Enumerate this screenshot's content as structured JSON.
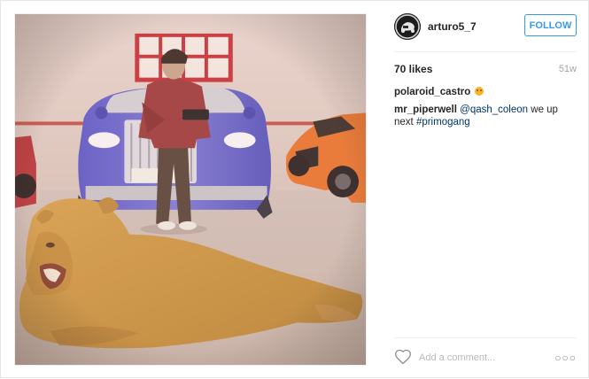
{
  "post": {
    "image_alt": "Man standing in a garage with a Rolls-Royce and an orange Lamborghini, a lioness lying on the floor in front",
    "icons": {
      "heart": "heart-outline-icon",
      "more": "more-options-icon"
    }
  },
  "header": {
    "username": "arturo5_7",
    "follow_label": "FOLLOW"
  },
  "stats": {
    "likes": "70 likes",
    "age": "51w"
  },
  "comments": [
    {
      "user": "polaroid_castro",
      "text": "",
      "emoji": "grinning-face"
    },
    {
      "user": "mr_piperwell",
      "mention": "@qash_coleon",
      "text": " we up next ",
      "hashtag": "#primogang"
    }
  ],
  "footer": {
    "comment_placeholder": "Add a comment...",
    "more_label": "○○○"
  },
  "colors": {
    "accent": "#3897f0",
    "link": "#003569",
    "muted": "#a5a5a5"
  }
}
